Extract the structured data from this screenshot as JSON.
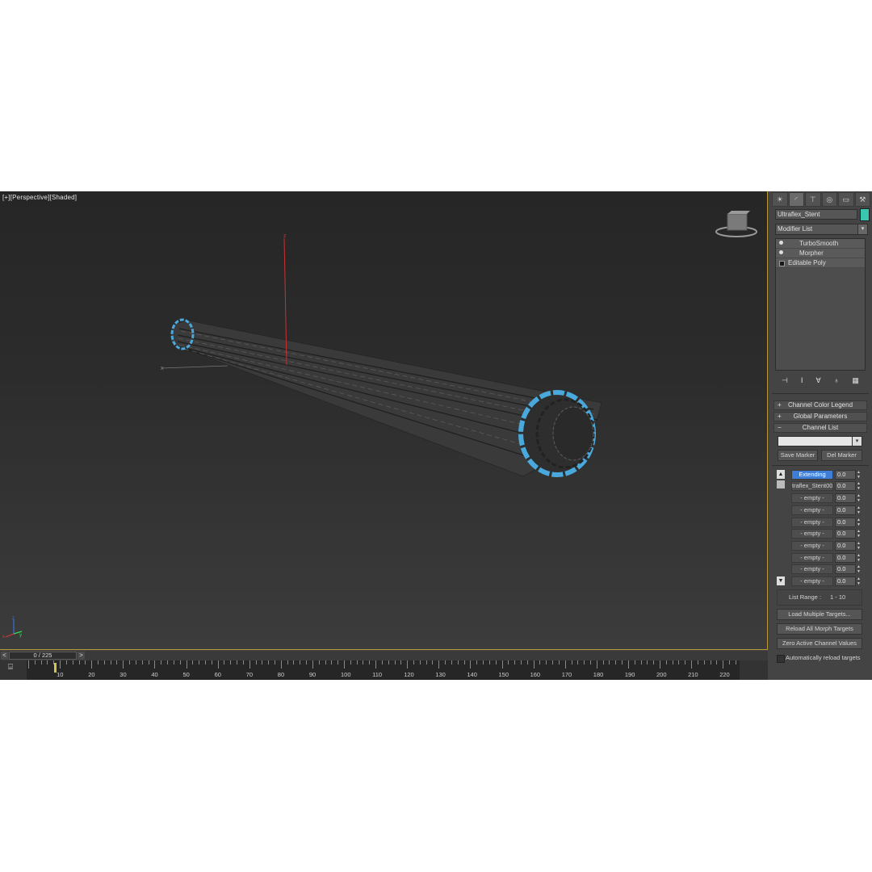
{
  "viewport": {
    "label": "[+][Perspective][Shaded]",
    "axis_z_label": "z",
    "axis_x_label": "x"
  },
  "command_panel": {
    "tab_icons": [
      "create-icon",
      "modify-icon",
      "hierarchy-icon",
      "motion-icon",
      "display-icon",
      "utilities-icon"
    ],
    "object_name": "Ultraflex_Stent",
    "object_color": "#3ac7b0",
    "modifier_list_label": "Modifier List",
    "stack": [
      {
        "label": "TurboSmooth",
        "icon": "lightbulb-icon"
      },
      {
        "label": "Morpher",
        "icon": "lightbulb-icon"
      },
      {
        "label": "Editable Poly",
        "icon": "square-icon"
      }
    ],
    "rollouts": {
      "channel_color_legend": "Channel Color Legend",
      "global_parameters": "Global Parameters",
      "channel_list": "Channel List"
    },
    "marker_dropdown_value": "",
    "save_marker": "Save Marker",
    "del_marker": "Del Marker",
    "channels": [
      {
        "name": "Extending",
        "value": "0.0"
      },
      {
        "name": "traflex_Stent00",
        "value": "0.0"
      },
      {
        "name": "- empty -",
        "value": "0.0"
      },
      {
        "name": "- empty -",
        "value": "0.0"
      },
      {
        "name": "- empty -",
        "value": "0.0"
      },
      {
        "name": "- empty -",
        "value": "0.0"
      },
      {
        "name": "- empty -",
        "value": "0.0"
      },
      {
        "name": "- empty -",
        "value": "0.0"
      },
      {
        "name": "- empty -",
        "value": "0.0"
      },
      {
        "name": "- empty -",
        "value": "0.0"
      }
    ],
    "list_range_label": "List Range :",
    "list_range_value": "1 - 10",
    "load_multiple_targets": "Load Multiple Targets...",
    "reload_all_morph_targets": "Reload All Morph Targets",
    "zero_active_channel_values": "Zero Active Channel Values",
    "automatically_reload_targets": "Automatically reload targets",
    "selected_channel_color": "#3e7ed6"
  },
  "timeline": {
    "frame_display": "0 / 225",
    "prev": "<",
    "next": ">",
    "tick_labels": [
      "10",
      "20",
      "30",
      "40",
      "50",
      "60",
      "70",
      "80",
      "90",
      "100",
      "110",
      "120",
      "130",
      "140",
      "150",
      "160",
      "170",
      "180",
      "190",
      "200",
      "210",
      "220"
    ]
  }
}
